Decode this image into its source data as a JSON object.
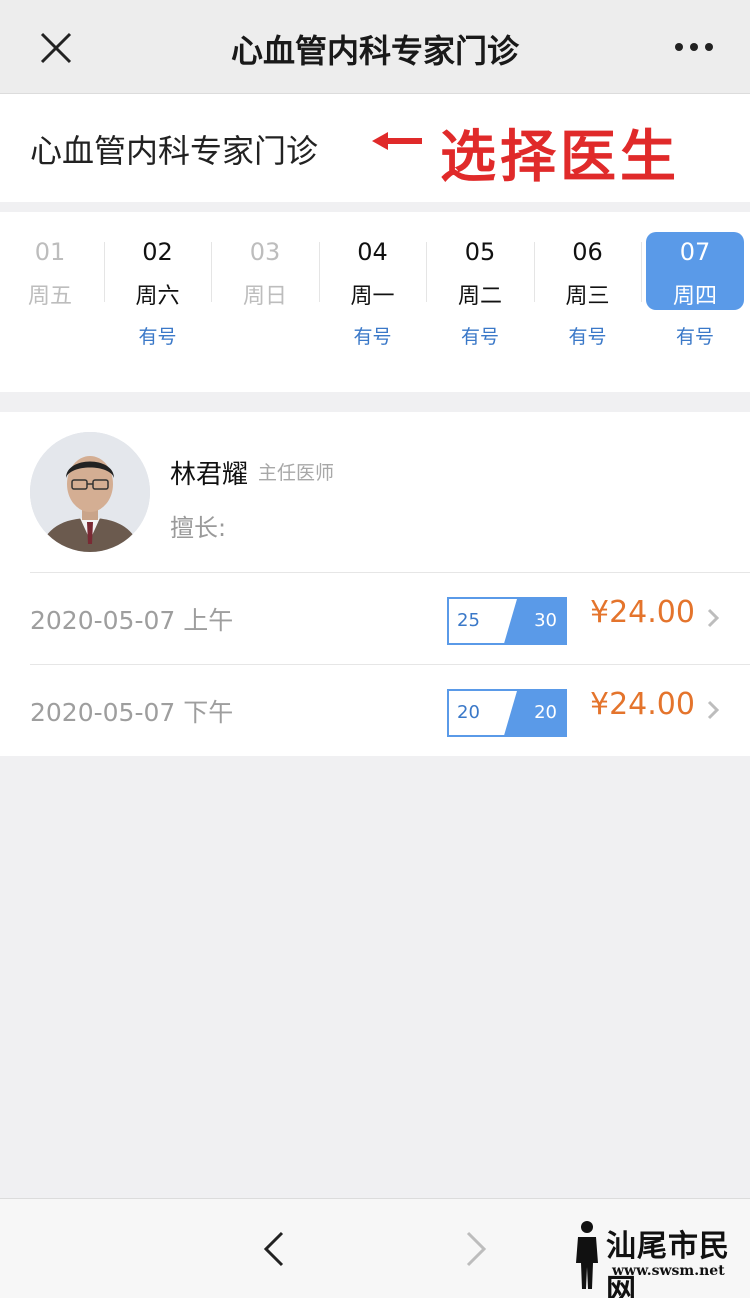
{
  "header": {
    "title": "心血管内科专家门诊",
    "close_icon": "close-icon",
    "more_icon": "more-icon"
  },
  "department": {
    "name": "心血管内科专家门诊",
    "annotation": "选择医生"
  },
  "dates": [
    {
      "day": "01",
      "weekday": "周五",
      "availability": "",
      "state": "disabled"
    },
    {
      "day": "02",
      "weekday": "周六",
      "availability": "有号",
      "state": "enabled"
    },
    {
      "day": "03",
      "weekday": "周日",
      "availability": "",
      "state": "disabled"
    },
    {
      "day": "04",
      "weekday": "周一",
      "availability": "有号",
      "state": "enabled"
    },
    {
      "day": "05",
      "weekday": "周二",
      "availability": "有号",
      "state": "enabled"
    },
    {
      "day": "06",
      "weekday": "周三",
      "availability": "有号",
      "state": "enabled"
    },
    {
      "day": "07",
      "weekday": "周四",
      "availability": "有号",
      "state": "selected"
    }
  ],
  "doctor": {
    "name": "林君耀",
    "title": "主任医师",
    "specialty_label": "擅长:",
    "slots": [
      {
        "datetime": "2020-05-07 上午",
        "remaining": "25",
        "total": "30",
        "price": "¥24.00"
      },
      {
        "datetime": "2020-05-07 下午",
        "remaining": "20",
        "total": "20",
        "price": "¥24.00"
      }
    ]
  },
  "toolbar": {
    "back_icon": "chevron-left-icon",
    "forward_icon": "chevron-right-icon"
  },
  "watermark": {
    "text": "汕尾市民网",
    "url": "www.swsm.net"
  },
  "colors": {
    "accent": "#5a9ae8",
    "price": "#e4742c",
    "annotation": "#e02a2a"
  }
}
